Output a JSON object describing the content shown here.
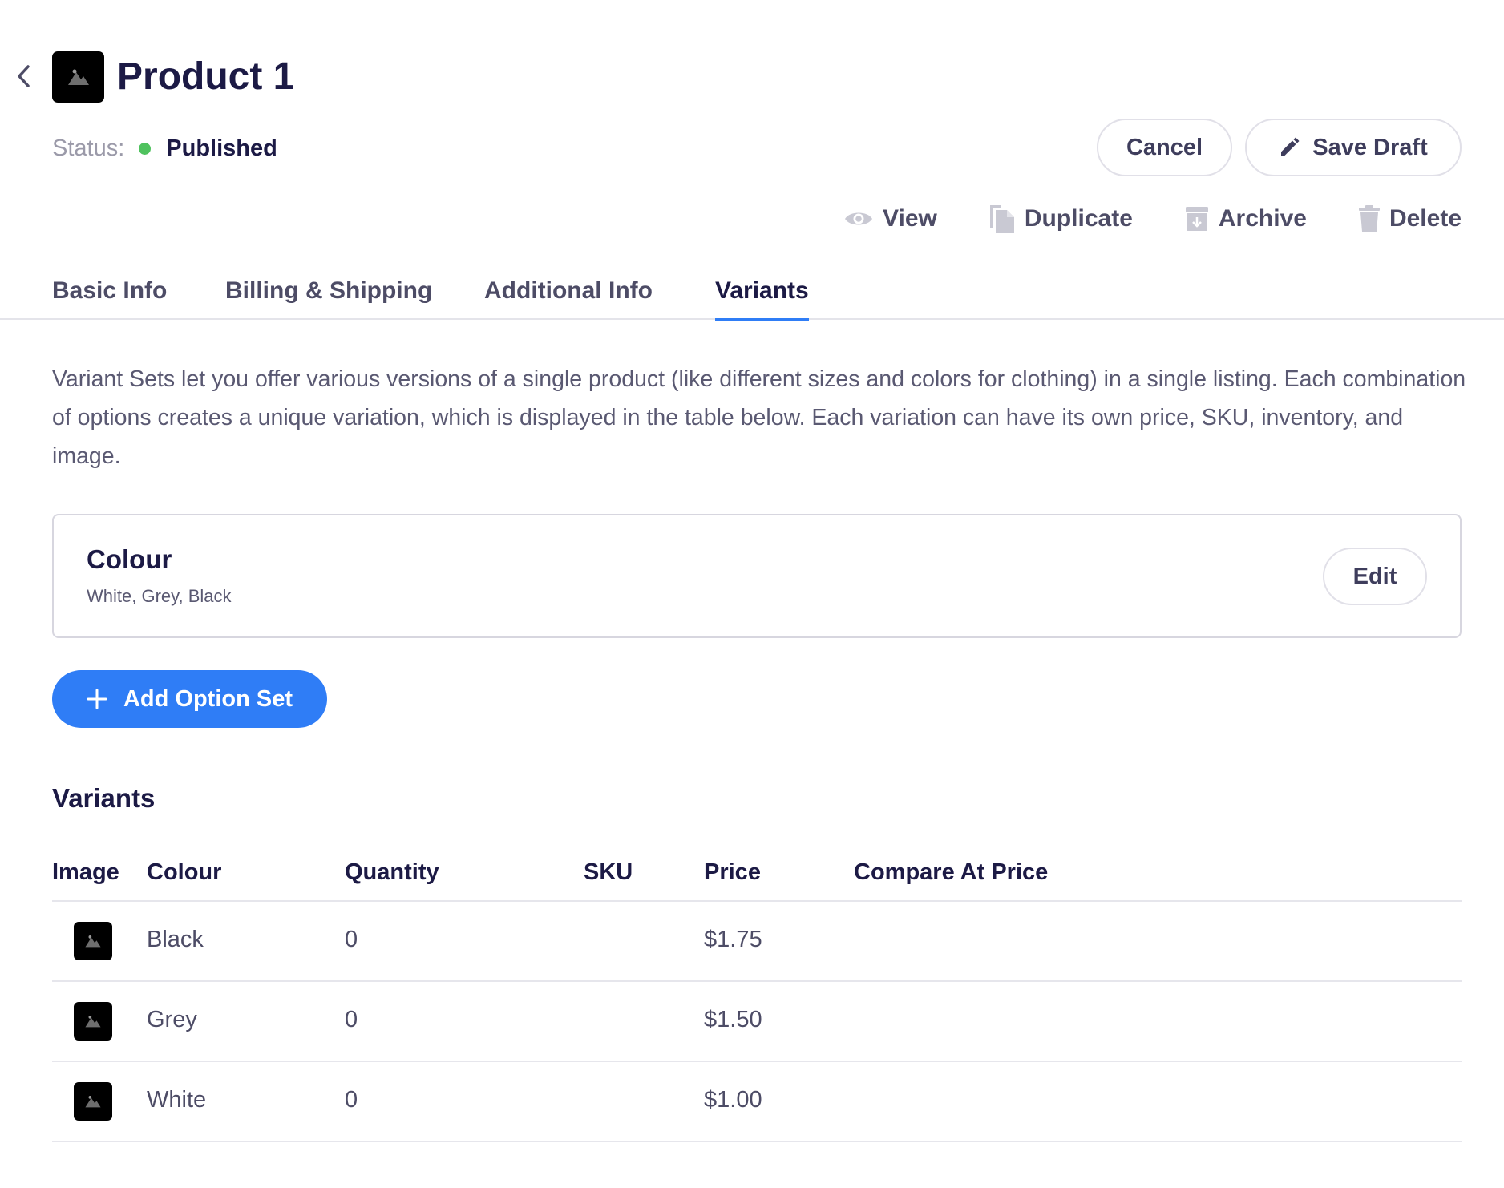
{
  "product": {
    "title": "Product 1",
    "status_label": "Status:",
    "status_value": "Published",
    "status_color": "#4fc25e"
  },
  "header": {
    "cancel_label": "Cancel",
    "save_draft_label": "Save Draft",
    "actions": [
      {
        "label": "View",
        "icon": "eye-icon"
      },
      {
        "label": "Duplicate",
        "icon": "copy-icon"
      },
      {
        "label": "Archive",
        "icon": "archive-icon"
      },
      {
        "label": "Delete",
        "icon": "trash-icon"
      }
    ]
  },
  "tabs": [
    {
      "label": "Basic Info",
      "active": false
    },
    {
      "label": "Billing & Shipping",
      "active": false
    },
    {
      "label": "Additional Info",
      "active": false
    },
    {
      "label": "Variants",
      "active": true
    }
  ],
  "variants_page": {
    "description": "Variant Sets let you offer various versions of a single product (like different sizes and colors for clothing) in a single listing. Each combination of options creates a unique variation, which is displayed in the table below. Each variation can have its own price, SKU, inventory, and image.",
    "option_set": {
      "name": "Colour",
      "values": "White, Grey, Black",
      "edit_label": "Edit"
    },
    "add_option_set_label": "Add Option Set",
    "variants_heading": "Variants",
    "table": {
      "columns": [
        "Image",
        "Colour",
        "Quantity",
        "SKU",
        "Price",
        "Compare At Price"
      ],
      "rows": [
        {
          "colour": "Black",
          "quantity": "0",
          "sku": "",
          "price": "$1.75",
          "compare_at_price": ""
        },
        {
          "colour": "Grey",
          "quantity": "0",
          "sku": "",
          "price": "$1.50",
          "compare_at_price": ""
        },
        {
          "colour": "White",
          "quantity": "0",
          "sku": "",
          "price": "$1.00",
          "compare_at_price": ""
        }
      ]
    }
  },
  "colors": {
    "accent": "#2f7df6",
    "heading": "#1c1a45",
    "text": "#4d4c66"
  }
}
